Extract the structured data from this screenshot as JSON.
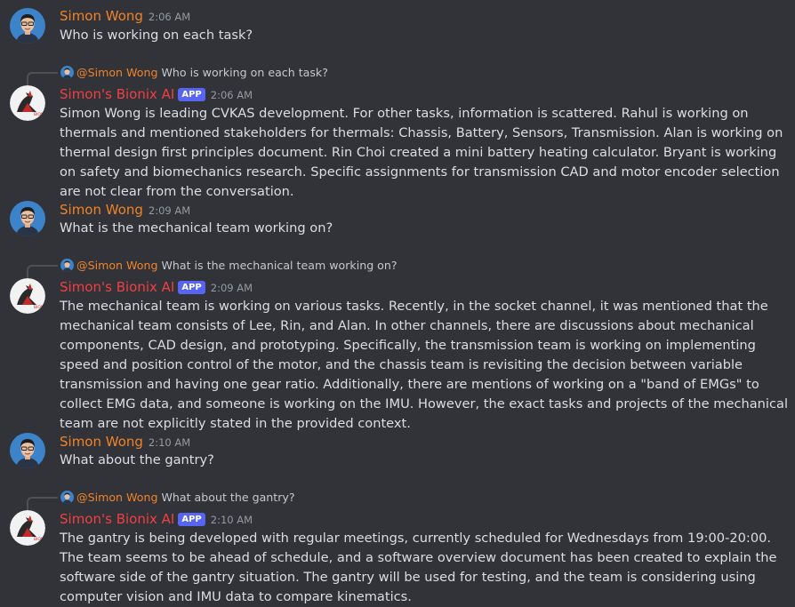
{
  "colors": {
    "background": "#313338",
    "user_name": "#f0832a",
    "bot_name": "#f23f43",
    "app_badge": "#5865f2",
    "timestamp": "#949ba4",
    "message_text": "#dbdee1"
  },
  "messages": [
    {
      "type": "user",
      "author": "Simon Wong",
      "time": "2:06 AM",
      "text": "Who is working on each task?",
      "avatar_icon": "user-avatar-icon"
    },
    {
      "type": "bot",
      "reply_mention": "@Simon Wong",
      "reply_text": "Who is working on each task?",
      "author": "Simon's Bionix AI",
      "badge": "APP",
      "time": "2:06 AM",
      "text": "Simon Wong is leading CVKAS development. For other tasks, information is scattered. Rahul is working on thermals and mentioned stakeholders for thermals: Chassis, Battery, Sensors, Transmission. Alan is working on thermal design first principles document. Rin Choi created a mini battery heating calculator. Bryant is working on safety and biomechanics research. Specific assignments for transmission CAD and motor encoder selection are not clear from the conversation.",
      "avatar_icon": "bionix-logo-icon"
    },
    {
      "type": "user",
      "author": "Simon Wong",
      "time": "2:09 AM",
      "text": "What is the mechanical team working on?",
      "avatar_icon": "user-avatar-icon"
    },
    {
      "type": "bot",
      "reply_mention": "@Simon Wong",
      "reply_text": "What is the mechanical team working on?",
      "author": "Simon's Bionix AI",
      "badge": "APP",
      "time": "2:09 AM",
      "text": "The mechanical team is working on various tasks. Recently, in the socket channel, it was mentioned that the mechanical team consists of Lee, Rin, and Alan. In other channels, there are discussions about mechanical components, CAD design, and prototyping. Specifically, the transmission team is working on implementing speed and position control of the motor, and the chassis team is revisiting the decision between variable transmission and having one gear ratio. Additionally, there are mentions of working on a \"band of EMGs\" to collect EMG data, and someone is working on the IMU. However, the exact tasks and projects of the mechanical team are not explicitly stated in the provided context.",
      "avatar_icon": "bionix-logo-icon"
    },
    {
      "type": "user",
      "author": "Simon Wong",
      "time": "2:10 AM",
      "text": "What about the gantry?",
      "avatar_icon": "user-avatar-icon"
    },
    {
      "type": "bot",
      "reply_mention": "@Simon Wong",
      "reply_text": "What about the gantry?",
      "author": "Simon's Bionix AI",
      "badge": "APP",
      "time": "2:10 AM",
      "text": "The gantry is being developed with regular meetings, currently scheduled for Wednesdays from 19:00-20:00. The team seems to be ahead of schedule, and a software overview document has been created to explain the software side of the gantry situation. The gantry will be used for testing, and the team is considering using computer vision and IMU data to compare kinematics.",
      "avatar_icon": "bionix-logo-icon"
    }
  ]
}
